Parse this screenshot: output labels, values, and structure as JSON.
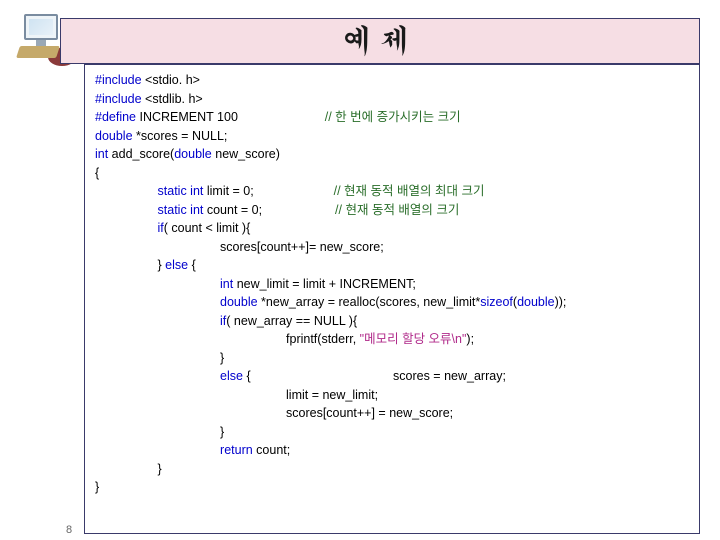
{
  "title": "예제",
  "page_number": "8",
  "code": {
    "l01a": "#include",
    "l01b": " <stdio. h>",
    "l02a": "#include",
    "l02b": " <stdlib. h>",
    "l03a": "#define",
    "l03b": " INCREMENT 100",
    "l03c": "// 한 번에 증가시키는 크기",
    "l04a": "double",
    "l04b": " *scores = NULL;",
    "l05a": "int",
    "l05b": " add_score(",
    "l05c": "double",
    "l05d": " new_score)",
    "l06": "{",
    "l07a": "static int",
    "l07b": " limit = 0;",
    "l07c": "// 현재 동적 배열의 최대 크기",
    "l08a": "static int",
    "l08b": " count = 0;",
    "l08c": "// 현재 동적 배열의 크기",
    "l09a": "if",
    "l09b": "( count < limit ){",
    "l10": "scores[count++]= new_score;",
    "l11a": "} ",
    "l11b": "else",
    "l11c": " {",
    "l12a": "int",
    "l12b": " new_limit = limit + INCREMENT;",
    "l13a": "double",
    "l13b": " *new_array = realloc(scores, new_limit*",
    "l13c": "sizeof",
    "l13d": "(",
    "l13e": "double",
    "l13f": "));",
    "l14a": "if",
    "l14b": "( new_array == NULL ){",
    "l15a": "fprintf(stderr, ",
    "l15b": "\"메모리 할당 오류\\n\"",
    "l15c": ");",
    "l16": "}",
    "l17a": "else",
    "l17b": " {",
    "l17c": "scores = new_array;",
    "l18": "limit = new_limit;",
    "l19": "scores[count++] = new_score;",
    "l20": "}",
    "l21a": "return",
    "l21b": " count;",
    "l22": "}",
    "l23": "}"
  }
}
